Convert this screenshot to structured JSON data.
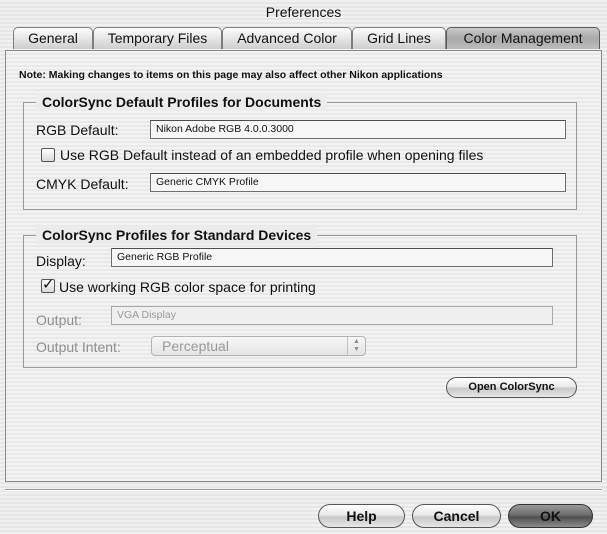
{
  "window": {
    "title": "Preferences"
  },
  "tabs": [
    {
      "label": "General",
      "selected": false
    },
    {
      "label": "Temporary Files",
      "selected": false
    },
    {
      "label": "Advanced Color",
      "selected": false
    },
    {
      "label": "Grid Lines",
      "selected": false
    },
    {
      "label": "Color Management",
      "selected": true
    }
  ],
  "note": "Note: Making changes to items on this page may also affect other Nikon applications",
  "documents_group": {
    "title": "ColorSync Default Profiles for Documents",
    "rgb_label": "RGB Default:",
    "rgb_value": "Nikon Adobe RGB 4.0.0.3000",
    "use_rgb_checkbox_label": "Use RGB Default instead of an embedded profile when opening files",
    "use_rgb_checked": false,
    "cmyk_label": "CMYK Default:",
    "cmyk_value": "Generic CMYK Profile"
  },
  "devices_group": {
    "title": "ColorSync Profiles for Standard Devices",
    "display_label": "Display:",
    "display_value": "Generic RGB Profile",
    "printing_checkbox_label": "Use working RGB color space for printing",
    "printing_checked": true,
    "output_label": "Output:",
    "output_value": "VGA Display",
    "intent_label": "Output Intent:",
    "intent_value": "Perceptual"
  },
  "buttons": {
    "open_colorsync": "Open ColorSync",
    "help": "Help",
    "cancel": "Cancel",
    "ok": "OK"
  },
  "colors": {
    "selected_tab": "#a9a9a9",
    "disabled_text": "#8f8f8f",
    "default_button": "#5a5a5a"
  }
}
